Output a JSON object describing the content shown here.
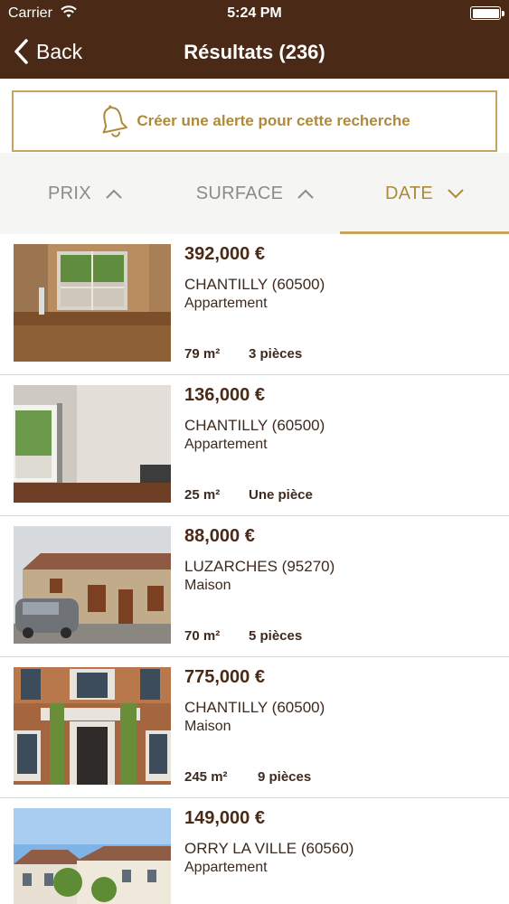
{
  "status": {
    "carrier": "Carrier",
    "time": "5:24 PM"
  },
  "nav": {
    "back_label": "Back",
    "title": "Résultats (236)"
  },
  "alert": {
    "label": "Créer une alerte pour cette recherche",
    "icon": "bell-icon"
  },
  "sort": {
    "tabs": [
      {
        "label": "PRIX",
        "direction": "up",
        "active": false
      },
      {
        "label": "SURFACE",
        "direction": "up",
        "active": false
      },
      {
        "label": "DATE",
        "direction": "down",
        "active": true
      }
    ]
  },
  "colors": {
    "brand": "#4a2a17",
    "accent": "#c7a560",
    "accent_text": "#ad8a3c"
  },
  "listings": [
    {
      "price": "392,000 €",
      "city": "CHANTILLY (60500)",
      "type": "Appartement",
      "surface": "79 m²",
      "rooms": "3 pièces"
    },
    {
      "price": "136,000 €",
      "city": "CHANTILLY (60500)",
      "type": "Appartement",
      "surface": "25 m²",
      "rooms": "Une pièce"
    },
    {
      "price": "88,000 €",
      "city": "LUZARCHES (95270)",
      "type": "Maison",
      "surface": "70 m²",
      "rooms": "5 pièces"
    },
    {
      "price": "775,000 €",
      "city": "CHANTILLY (60500)",
      "type": "Maison",
      "surface": "245 m²",
      "rooms": "9 pièces"
    },
    {
      "price": "149,000 €",
      "city": "ORRY LA VILLE (60560)",
      "type": "Appartement",
      "surface": "",
      "rooms": ""
    }
  ]
}
